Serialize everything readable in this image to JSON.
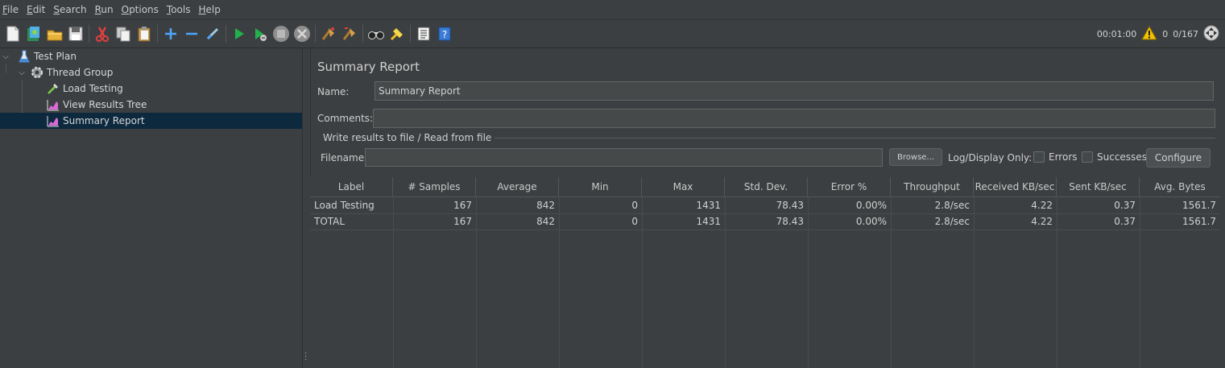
{
  "menu": {
    "items": [
      {
        "first": "F",
        "rest": "ile"
      },
      {
        "first": "E",
        "rest": "dit"
      },
      {
        "first": "S",
        "rest": "earch"
      },
      {
        "first": "R",
        "rest": "un"
      },
      {
        "first": "O",
        "rest": "ptions"
      },
      {
        "first": "T",
        "rest": "ools"
      },
      {
        "first": "H",
        "rest": "elp"
      }
    ]
  },
  "toolbar": {
    "icons": [
      "new-icon",
      "templates-icon",
      "open-icon",
      "save-icon",
      "cut-icon",
      "copy-icon",
      "paste-icon",
      "expand-icon",
      "collapse-icon",
      "toggle-icon",
      "start-icon",
      "start-no-pause-icon",
      "stop-icon",
      "shutdown-icon",
      "clear-icon",
      "clear-all-icon",
      "search-icon",
      "reset-search-icon",
      "function-helper-icon",
      "help-icon"
    ],
    "timer": "00:01:00",
    "warnings": "0",
    "threads": "0/167"
  },
  "tree": {
    "items": [
      {
        "label": "Test Plan",
        "icon": "flask-icon"
      },
      {
        "label": "Thread Group",
        "icon": "gear-icon"
      },
      {
        "label": "Load Testing",
        "icon": "pipette-icon"
      },
      {
        "label": "View Results Tree",
        "icon": "graph-icon"
      },
      {
        "label": "Summary Report",
        "icon": "graph-icon"
      }
    ]
  },
  "panel": {
    "title": "Summary Report",
    "name_label": "Name:",
    "name_value": "Summary Report",
    "comments_label": "Comments:",
    "comments_value": "",
    "file_group_title": "Write results to file / Read from file",
    "filename_label": "Filename",
    "filename_value": "",
    "browse_label": "Browse...",
    "log_display_label": "Log/Display Only:",
    "errors_label": "Errors",
    "successes_label": "Successes",
    "configure_label": "Configure"
  },
  "table": {
    "columns": [
      "Label",
      "# Samples",
      "Average",
      "Min",
      "Max",
      "Std. Dev.",
      "Error %",
      "Throughput",
      "Received KB/sec",
      "Sent KB/sec",
      "Avg. Bytes"
    ],
    "rows": [
      [
        "Load Testing",
        "167",
        "842",
        "0",
        "1431",
        "78.43",
        "0.00%",
        "2.8/sec",
        "4.22",
        "0.37",
        "1561.7"
      ],
      [
        "TOTAL",
        "167",
        "842",
        "0",
        "1431",
        "78.43",
        "0.00%",
        "2.8/sec",
        "4.22",
        "0.37",
        "1561.7"
      ]
    ]
  },
  "colors": {
    "background": "#3c3f41",
    "selection": "#0d293e",
    "text": "#d0d0d0"
  }
}
